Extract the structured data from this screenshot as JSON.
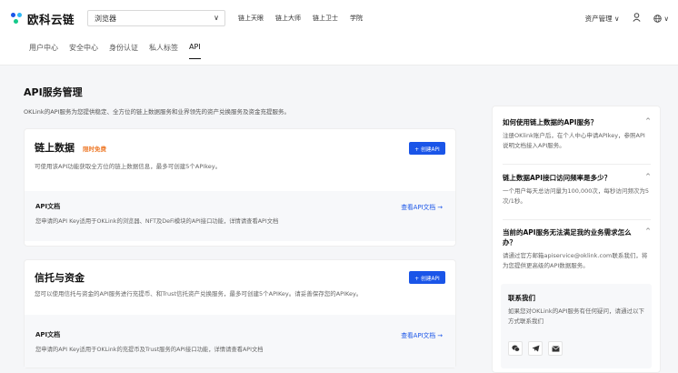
{
  "header": {
    "logo_text": "欧科云链",
    "search_select": "浏览器",
    "nav": [
      "链上天眼",
      "链上大师",
      "链上卫士",
      "学院"
    ],
    "asset_mgmt": "资产管理 ∨",
    "user_icon": "user-icon",
    "globe_icon": "globe-icon",
    "globe_chevron": "∨",
    "brand_colors": [
      "#1a55e8",
      "#2db7f5",
      "#14c98a"
    ]
  },
  "subnav": {
    "tabs": [
      "用户中心",
      "安全中心",
      "身份认证",
      "私人标签",
      "API"
    ],
    "active_index": 4
  },
  "main": {
    "title": "API服务管理",
    "desc": "OKLink的API服务为您提供稳定、全方位的链上数据服务和业界领先的资产兑换服务及资金充提服务。",
    "cards": [
      {
        "title": "链上数据",
        "badge": "限时免费",
        "desc": "可使用该API功能获取全方位的链上数据信息，最多可创建5个APIkey。",
        "create_btn": "+ 创建API",
        "doc_title": "API文档",
        "doc_desc": "您申请的API Key适用于OKLink的浏览器、NFT及DeFi模块的API接口功能，详情请查看API文档",
        "doc_link": "查看API文档 →"
      },
      {
        "title": "信托与资金",
        "desc": "您可以使用信托与资金的API服务进行充提币、和Trust信托资产兑换服务，最多可创建5个APIKey。请妥善保存您的APIKey。",
        "create_btn": "+ 创建API",
        "doc_title": "API文档",
        "doc_desc": "您申请的API Key适用于OKLink的充提币及Trust服务的API接口功能，详情请查看API文档",
        "doc_link": "查看API文档 →"
      }
    ]
  },
  "sidebar": {
    "faqs": [
      {
        "q": "如何使用链上数据的API服务？",
        "a": "注册OKlink账户后，在个人中心申请APIkey，参照API说明文档接入API服务。",
        "chev": "^"
      },
      {
        "q": "链上数据API接口访问频率是多少？",
        "a": "一个用户每天总访问量为100,000次，每秒访问频次为5次/1秒。",
        "chev": "^"
      },
      {
        "q": "当前的API服务无法满足我的业务需求怎么办？",
        "a": "请通过官方邮箱apiservice@oklink.com联系我们，将为您提供更高级的API数据服务。",
        "chev": "^"
      }
    ],
    "contact": {
      "title": "联系我们",
      "desc": "如果您对OKLink的API服务有任何疑问，请通过以下方式联系我们",
      "icons": [
        "wechat-icon",
        "telegram-icon",
        "email-icon"
      ]
    }
  }
}
